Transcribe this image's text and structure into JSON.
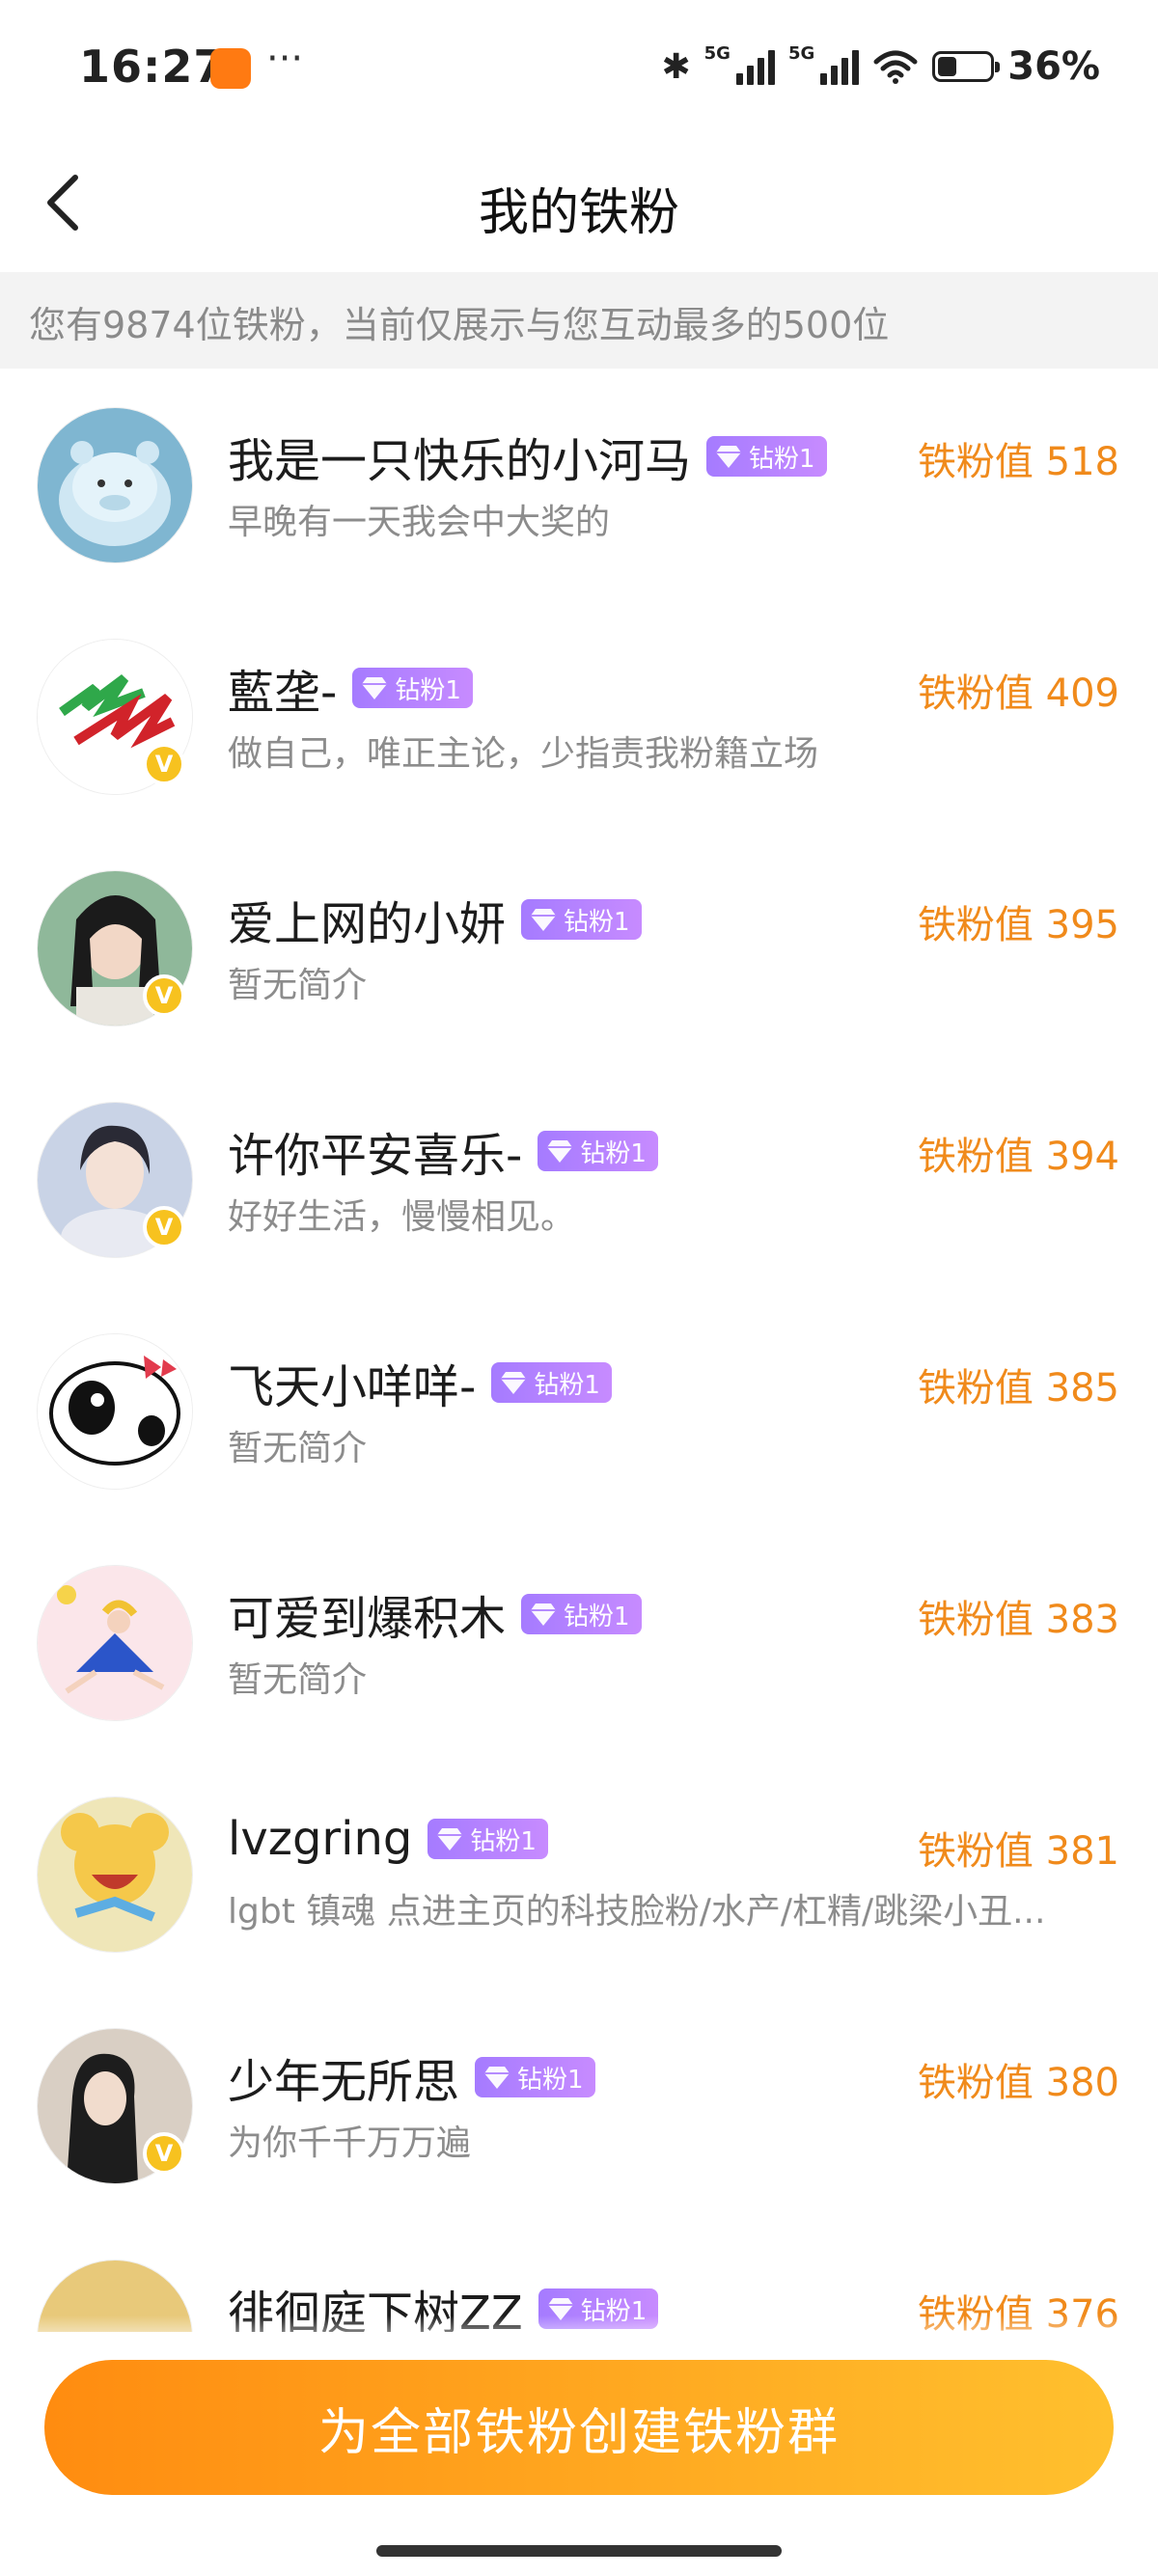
{
  "status_bar": {
    "time": "16:27",
    "more": "···",
    "network_1": "5G",
    "network_2": "5G",
    "battery_pct": "36%",
    "battery_level": 0.36,
    "icons": [
      "app-notification-icon",
      "bluetooth-icon",
      "signal-icon",
      "signal-icon",
      "wifi-icon",
      "battery-icon"
    ]
  },
  "nav": {
    "back_icon": "chevron-left-icon",
    "title": "我的铁粉"
  },
  "banner": {
    "text": "您有9874位铁粉，当前仅展示与您互动最多的500位"
  },
  "fans": [
    {
      "name": "我是一只快乐的小河马",
      "badge": "钻粉1",
      "bio": "早晚有一天我会中大奖的",
      "score": "铁粉值 518",
      "verified": false
    },
    {
      "name": "藍垄-",
      "badge": "钻粉1",
      "bio": "做自己，唯正主论，少指责我粉籍立场",
      "score": "铁粉值 409",
      "verified": true
    },
    {
      "name": "爱上网的小妍",
      "badge": "钻粉1",
      "bio": "暂无简介",
      "score": "铁粉值 395",
      "verified": true
    },
    {
      "name": "许你平安喜乐-",
      "badge": "钻粉1",
      "bio": "好好生活，慢慢相见。",
      "score": "铁粉值 394",
      "verified": true
    },
    {
      "name": "飞天小咩咩-",
      "badge": "钻粉1",
      "bio": "暂无简介",
      "score": "铁粉值 385",
      "verified": false
    },
    {
      "name": "可爱到爆积木",
      "badge": "钻粉1",
      "bio": "暂无简介",
      "score": "铁粉值 383",
      "verified": false
    },
    {
      "name": "lvzgring",
      "badge": "钻粉1",
      "bio": "lgbt 镇魂 点进主页的科技脸粉/水产/杠精/跳梁小丑...",
      "score": "铁粉值 381",
      "verified": false
    },
    {
      "name": "少年无所思",
      "badge": "钻粉1",
      "bio": "为你千千万万遍",
      "score": "铁粉值 380",
      "verified": true
    },
    {
      "name": "徘徊庭下树ZZ",
      "badge": "钻粉1",
      "bio": "",
      "score": "铁粉值 376",
      "verified": false
    }
  ],
  "verified_mark": "V",
  "cta": {
    "label": "为全部铁粉创建铁粉群"
  },
  "colors": {
    "accent_orange": "#f08a1b",
    "cta_start": "#ff8c10",
    "cta_end": "#ffc02e",
    "badge_purple": "#a57bff",
    "verified_yellow": "#f7c21f"
  }
}
